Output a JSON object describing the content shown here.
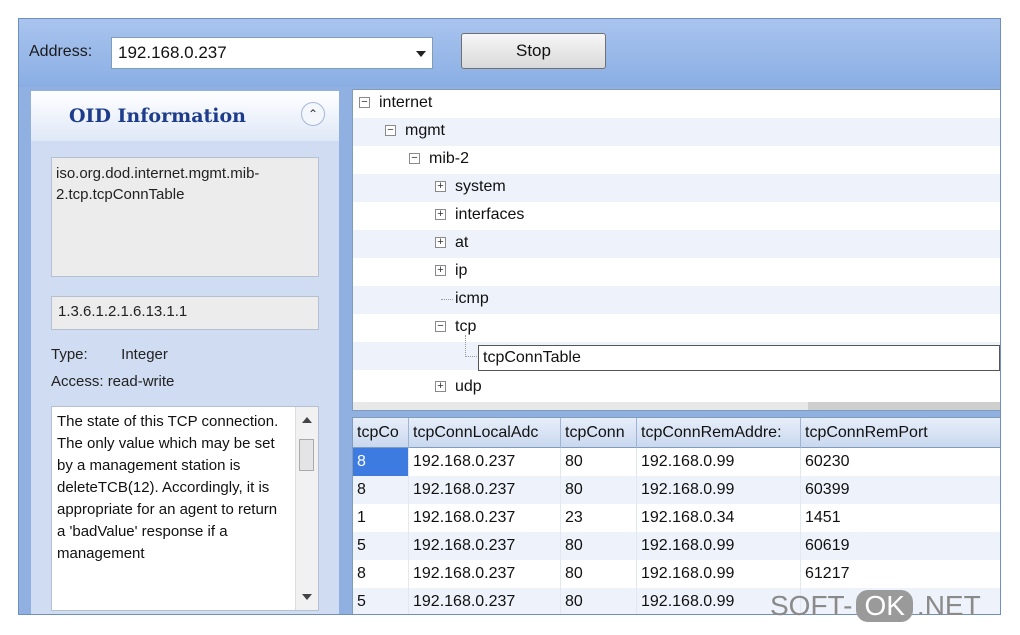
{
  "toolbar": {
    "address_label": "Address:",
    "address_value": "192.168.0.237",
    "stop_label": "Stop"
  },
  "oid_panel": {
    "title": "OID Information",
    "oid_path": "iso.org.dod.internet.mgmt.mib-2.tcp.tcpConnTable",
    "oid_number": "1.3.6.1.2.1.6.13.1.1",
    "type_label": "Type:",
    "type_value": "Integer",
    "access_label": "Access:",
    "access_value": "read-write",
    "description": "The state of this TCP connection. The only value which may be set by a management station is deleteTCB(12). Accordingly, it is appropriate for an agent to return a 'badValue' response if a management"
  },
  "tree": {
    "nodes": [
      {
        "label": "internet"
      },
      {
        "label": "mgmt"
      },
      {
        "label": "mib-2"
      },
      {
        "label": "system"
      },
      {
        "label": "interfaces"
      },
      {
        "label": "at"
      },
      {
        "label": "ip"
      },
      {
        "label": "icmp"
      },
      {
        "label": "tcp"
      },
      {
        "label": "tcpConnTable"
      },
      {
        "label": "udp"
      }
    ]
  },
  "table": {
    "columns": [
      "tcpCo",
      "tcpConnLocalAdc",
      "tcpConn",
      "tcpConnRemAddre:",
      "tcpConnRemPort"
    ],
    "rows": [
      [
        "8",
        "192.168.0.237",
        "80",
        "192.168.0.99",
        "60230"
      ],
      [
        "8",
        "192.168.0.237",
        "80",
        "192.168.0.99",
        "60399"
      ],
      [
        "1",
        "192.168.0.237",
        "23",
        "192.168.0.34",
        "1451"
      ],
      [
        "5",
        "192.168.0.237",
        "80",
        "192.168.0.99",
        "60619"
      ],
      [
        "8",
        "192.168.0.237",
        "80",
        "192.168.0.99",
        "61217"
      ],
      [
        "5",
        "192.168.0.237",
        "80",
        "192.168.0.99",
        ""
      ]
    ]
  },
  "watermark": {
    "left": "SOFT-",
    "mid": "OK",
    "right": ".NET"
  }
}
